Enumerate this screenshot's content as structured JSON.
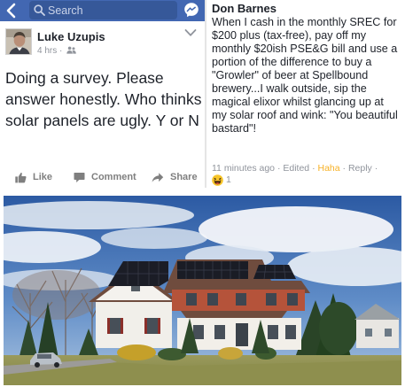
{
  "search": {
    "placeholder": "Search"
  },
  "post": {
    "author": "Luke Uzupis",
    "time": "4 hrs ·",
    "text": "Doing a survey. Please answer honestly. Who thinks solar panels are ugly. Y or N",
    "actions": {
      "like": "Like",
      "comment": "Comment",
      "share": "Share"
    }
  },
  "comment": {
    "author": "Don Barnes",
    "text": "When I cash in the monthly SREC for $200 plus (tax-free), pay off my monthly $20ish PSE&G bill and use a portion of the difference to buy a \"Growler\" of beer at Spellbound brewery...I walk outside, sip the magical elixor whilst glancing up at my solar roof and wink: \"You beautiful bastard\"!",
    "time": "11 minutes ago",
    "edited": "Edited",
    "reaction_label": "Haha",
    "reply": "Reply",
    "reaction_count": "1"
  },
  "colors": {
    "facebook_blue": "#4267b2",
    "haha_orange": "#f7b125",
    "meta_gray": "#90949c"
  },
  "icons": {
    "back": "chevron-left-icon",
    "search": "search-icon",
    "messenger": "messenger-icon",
    "audience": "friends-icon",
    "menu": "chevron-down-icon",
    "like": "thumbs-up-icon",
    "comment": "comment-icon",
    "share": "share-icon",
    "reaction": "haha-emoji-icon"
  }
}
